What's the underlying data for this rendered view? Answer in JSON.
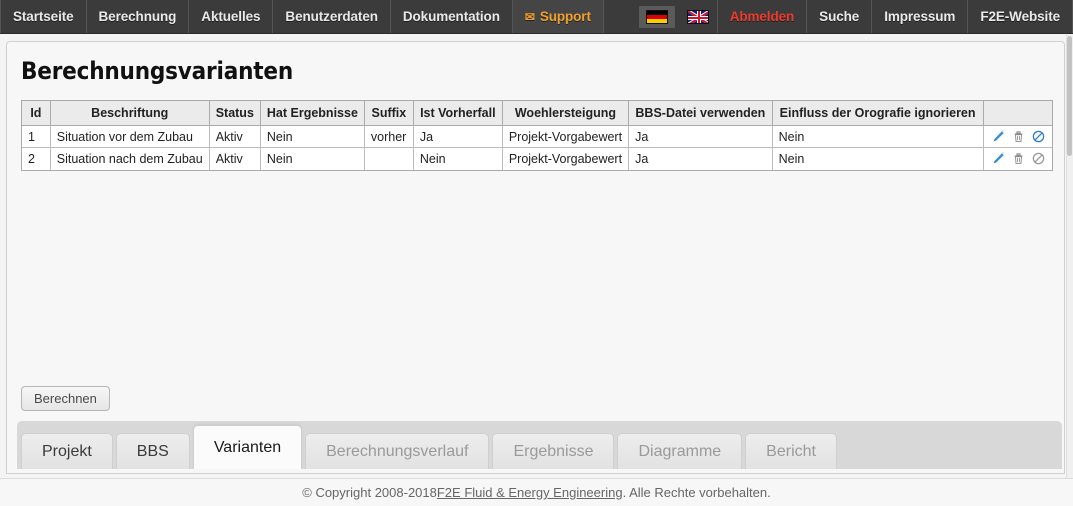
{
  "nav": {
    "items": [
      {
        "label": "Startseite",
        "kind": "normal"
      },
      {
        "label": "Berechnung",
        "kind": "normal"
      },
      {
        "label": "Aktuelles",
        "kind": "normal"
      },
      {
        "label": "Benutzerdaten",
        "kind": "normal"
      },
      {
        "label": "Dokumentation",
        "kind": "normal"
      },
      {
        "label": "Support",
        "kind": "support",
        "icon": "envelope-icon"
      }
    ],
    "right_items": [
      {
        "label": "Abmelden",
        "kind": "logout",
        "color": "#ee3b2f"
      },
      {
        "label": "Suche",
        "kind": "normal"
      },
      {
        "label": "Impressum",
        "kind": "normal"
      },
      {
        "label": "F2E-Website",
        "kind": "normal"
      }
    ],
    "flags": [
      {
        "name": "flag-de-icon",
        "title": "Deutsch",
        "selected": true
      },
      {
        "name": "flag-gb-icon",
        "title": "English",
        "selected": false
      }
    ],
    "support_icon_glyph": "✉",
    "bg_color": "#3b3b3b",
    "support_color": "#f0a02c"
  },
  "page": {
    "title": "Berechnungsvarianten"
  },
  "table": {
    "headers": [
      "Id",
      "Beschriftung",
      "Status",
      "Hat Ergebnisse",
      "Suffix",
      "Ist Vorherfall",
      "Woehlersteigung",
      "BBS-Datei verwenden",
      "Einfluss der Orografie ignorieren",
      ""
    ],
    "rows": [
      {
        "id": "1",
        "beschriftung": "Situation vor dem Zubau",
        "status": "Aktiv",
        "hat_ergebnisse": "Nein",
        "suffix": "vorher",
        "ist_vorherfall": "Ja",
        "woehlersteigung": "Projekt-Vorgabewert",
        "bbs_datei": "Ja",
        "orografie": "Nein",
        "actions": [
          "edit-icon",
          "delete-icon",
          "disable-icon"
        ],
        "disable_active": true
      },
      {
        "id": "2",
        "beschriftung": "Situation nach dem Zubau",
        "status": "Aktiv",
        "hat_ergebnisse": "Nein",
        "suffix": "",
        "ist_vorherfall": "Nein",
        "woehlersteigung": "Projekt-Vorgabewert",
        "bbs_datei": "Ja",
        "orografie": "Nein",
        "actions": [
          "edit-icon",
          "delete-icon",
          "disable-icon"
        ],
        "disable_active": false
      }
    ]
  },
  "buttons": {
    "berechnen": "Berechnen"
  },
  "tabs": [
    {
      "label": "Projekt",
      "state": "enabled"
    },
    {
      "label": "BBS",
      "state": "enabled"
    },
    {
      "label": "Varianten",
      "state": "active"
    },
    {
      "label": "Berechnungsverlauf",
      "state": "disabled"
    },
    {
      "label": "Ergebnisse",
      "state": "disabled"
    },
    {
      "label": "Diagramme",
      "state": "disabled"
    },
    {
      "label": "Bericht",
      "state": "disabled"
    }
  ],
  "footer": {
    "prefix": "© Copyright 2008-2018 ",
    "link": "F2E Fluid & Energy Engineering",
    "suffix": ". Alle Rechte vorbehalten."
  }
}
